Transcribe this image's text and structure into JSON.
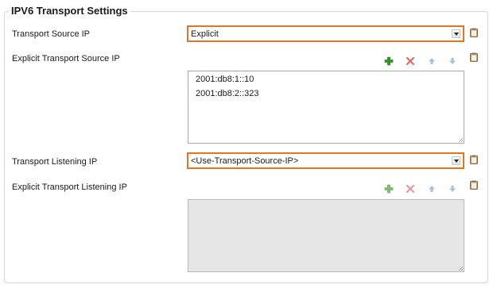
{
  "section": {
    "title": "IPV6 Transport Settings"
  },
  "transport_source_ip": {
    "label": "Transport Source IP",
    "value": "Explicit"
  },
  "explicit_transport_source_ip": {
    "label": "Explicit Transport Source IP",
    "items": [
      "2001:db8:1::10",
      "2001:db8:2::323"
    ]
  },
  "transport_listening_ip": {
    "label": "Transport Listening IP",
    "value": "<Use-Transport-Source-IP>"
  },
  "explicit_transport_listening_ip": {
    "label": "Explicit Transport Listening IP",
    "items": []
  },
  "colors": {
    "focus_border": "#e8741c",
    "add_green": "#2a9a1e",
    "delete_red": "#d9534f",
    "arrow_blue": "#a9bfd8",
    "disabled_bg": "#e6e6e6"
  },
  "icons": {
    "add": "plus-icon",
    "delete": "x-icon",
    "up": "arrow-up-icon",
    "down": "arrow-down-icon",
    "note": "clipboard-icon",
    "dropdown": "chevron-down-icon"
  }
}
